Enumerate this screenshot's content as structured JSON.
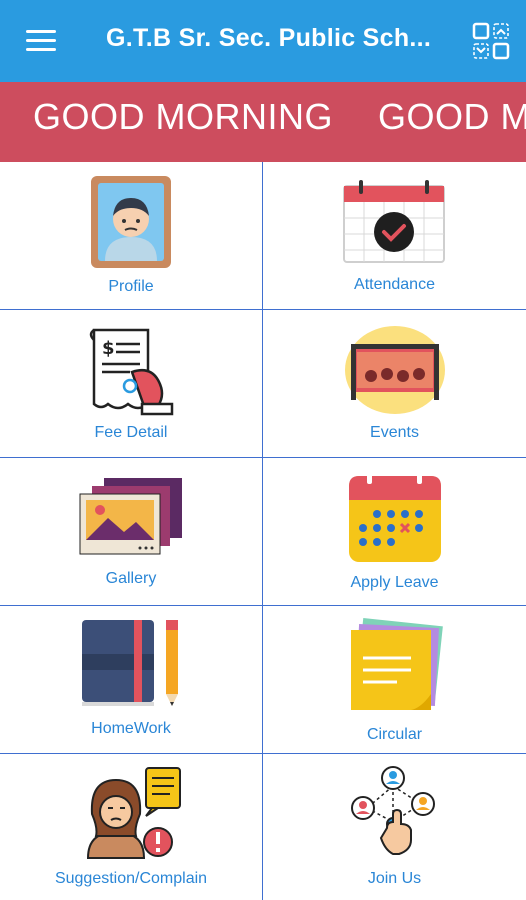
{
  "appbar": {
    "title": "G.T.B Sr. Sec. Public Sch...",
    "menu_icon": "hamburger-menu-icon",
    "switch_icon": "switch-account-icon"
  },
  "greeting": {
    "text_1": "GOOD MORNING",
    "text_2": "GOOD M"
  },
  "tiles": [
    {
      "label": "Profile",
      "icon": "profile-portrait-icon"
    },
    {
      "label": "Attendance",
      "icon": "attendance-calendar-icon"
    },
    {
      "label": "Fee Detail",
      "icon": "fee-receipt-icon"
    },
    {
      "label": "Events",
      "icon": "events-stage-icon"
    },
    {
      "label": "Gallery",
      "icon": "gallery-photos-icon"
    },
    {
      "label": "Apply Leave",
      "icon": "leave-calendar-icon"
    },
    {
      "label": "HomeWork",
      "icon": "homework-notebook-icon"
    },
    {
      "label": "Circular",
      "icon": "circular-notes-icon"
    },
    {
      "label": "Suggestion/Complain",
      "icon": "suggestion-complain-icon"
    },
    {
      "label": "Join Us",
      "icon": "join-us-network-icon"
    }
  ],
  "colors": {
    "appbar": "#2a9be0",
    "greeting_bar": "#cd4d5e",
    "grid_lines": "#3f6fd0",
    "label_text": "#2a86d6"
  }
}
